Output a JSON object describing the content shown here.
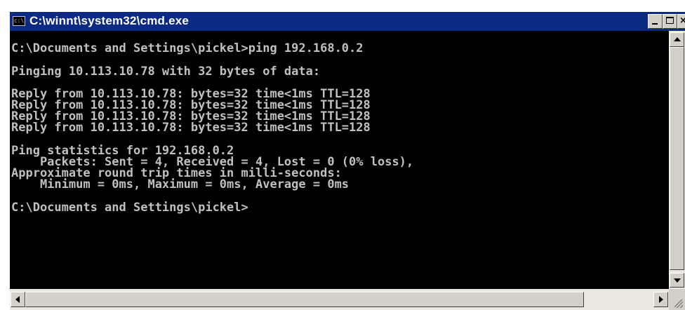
{
  "window": {
    "title": "C:\\winnt\\system32\\cmd.exe",
    "icon_label": "c:\\"
  },
  "console": {
    "lines": [
      "C:\\Documents and Settings\\pickel>ping 192.168.0.2",
      "Pinging 10.113.10.78 with 32 bytes of data:",
      "Reply from 10.113.10.78: bytes=32 time<1ms TTL=128",
      "Reply from 10.113.10.78: bytes=32 time<1ms TTL=128",
      "Reply from 10.113.10.78: bytes=32 time<1ms TTL=128",
      "Reply from 10.113.10.78: bytes=32 time<1ms TTL=128",
      "Ping statistics for 192.168.0.2",
      "    Packets: Sent = 4, Received = 4, Lost = 0 (0% loss),",
      "Approximate round trip times in milli-seconds:",
      "    Minimum = 0ms, Maximum = 0ms, Average = 0ms",
      "C:\\Documents and Settings\\pickel>"
    ]
  },
  "colors": {
    "titlebar": "#0b2a84",
    "console_bg": "#000000",
    "console_text": "#c0c0c0"
  },
  "icons": {
    "app": "cmd-icon",
    "minimize": "minimize-icon",
    "maximize": "maximize-icon",
    "close": "close-icon",
    "scroll_up": "arrow-up-icon",
    "scroll_down": "arrow-down-icon",
    "scroll_left": "arrow-left-icon",
    "scroll_right": "arrow-right-icon",
    "resize": "resize-grip-icon"
  }
}
